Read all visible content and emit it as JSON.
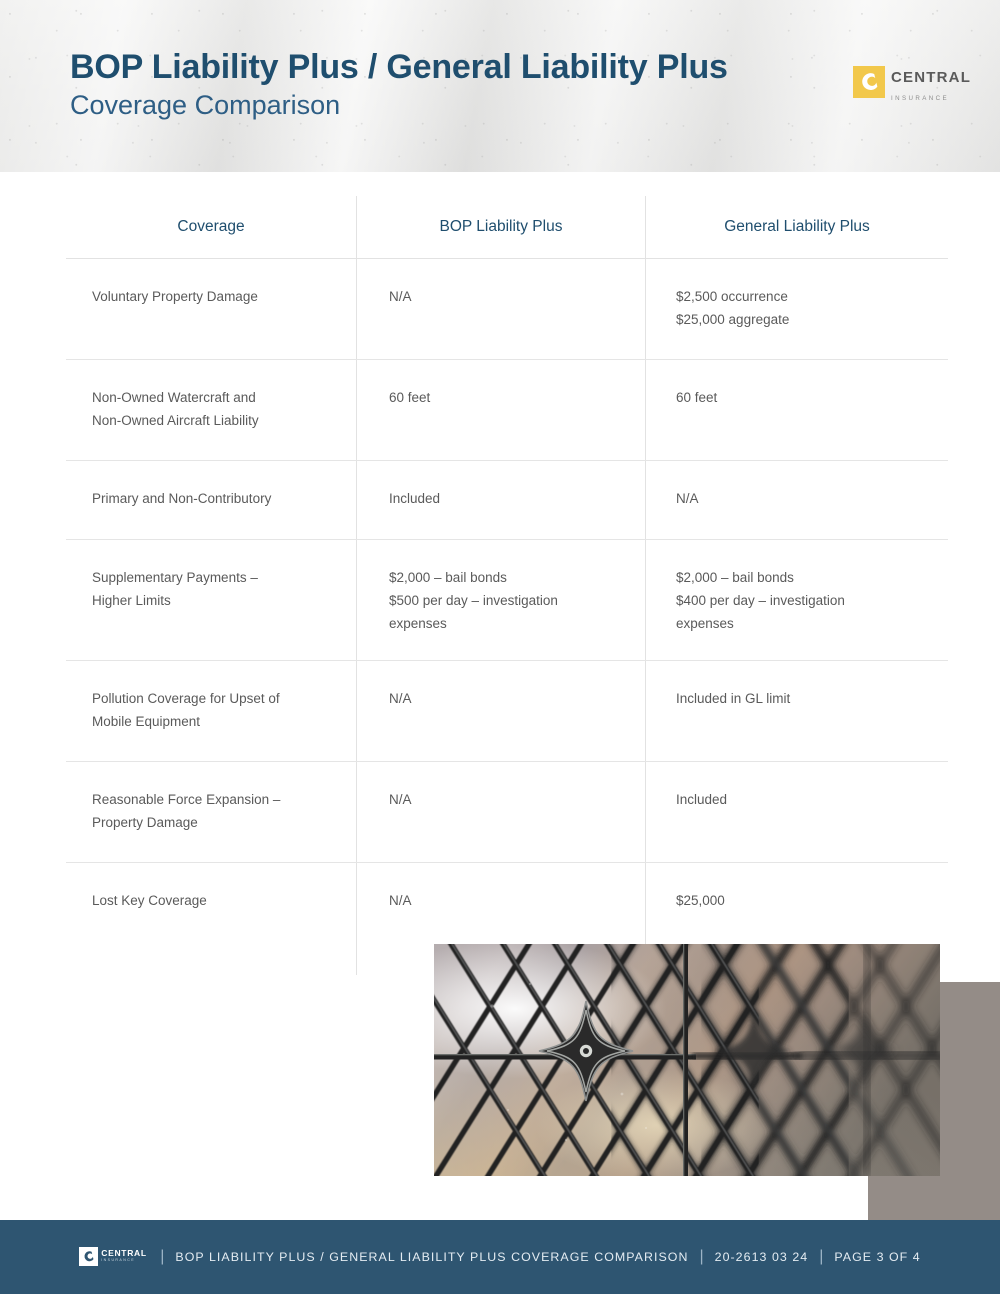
{
  "header": {
    "title": "BOP Liability Plus / General Liability Plus",
    "subtitle": "Coverage Comparison",
    "logo": {
      "name": "CENTRAL",
      "sub": "INSURANCE"
    },
    "colors": {
      "title": "#1F4E6E",
      "subtitle": "#2E5E85",
      "logo_gold": "#F2C84B"
    }
  },
  "table": {
    "columns": [
      "Coverage",
      "BOP Liability Plus",
      "General Liability Plus"
    ],
    "rows": [
      {
        "coverage": [
          "Voluntary Property Damage"
        ],
        "bop": [
          "N/A"
        ],
        "gl": [
          "$2,500 occurrence",
          "$25,000 aggregate"
        ]
      },
      {
        "coverage": [
          "Non-Owned Watercraft and",
          "Non-Owned Aircraft Liability"
        ],
        "bop": [
          "60 feet"
        ],
        "gl": [
          "60 feet"
        ]
      },
      {
        "coverage": [
          "Primary and Non-Contributory"
        ],
        "bop": [
          "Included"
        ],
        "gl": [
          "N/A"
        ]
      },
      {
        "coverage": [
          "Supplementary Payments –",
          "Higher Limits"
        ],
        "bop": [
          "$2,000 – bail bonds",
          "$500 per day – investigation",
          "expenses"
        ],
        "gl": [
          "$2,000 – bail bonds",
          "$400 per day – investigation",
          "expenses"
        ]
      },
      {
        "coverage": [
          "Pollution Coverage for Upset of",
          "Mobile Equipment"
        ],
        "bop": [
          "N/A"
        ],
        "gl": [
          "Included in GL limit"
        ]
      },
      {
        "coverage": [
          "Reasonable Force Expansion –",
          "Property Damage"
        ],
        "bop": [
          "N/A"
        ],
        "gl": [
          "Included"
        ]
      },
      {
        "coverage": [
          "Lost Key Coverage"
        ],
        "bop": [
          "N/A"
        ],
        "gl": [
          "$25,000"
        ]
      }
    ]
  },
  "photo": {
    "alt": "Leaded glass window with diamond lattice and four-point star rosette"
  },
  "accent": {
    "color": "#948C87"
  },
  "footer": {
    "logo": {
      "name": "CENTRAL",
      "sub": "INSURANCE"
    },
    "document_title": "BOP LIABILITY PLUS / GENERAL LIABILITY PLUS COVERAGE COMPARISON",
    "document_number": "20-2613 03 24",
    "page_label": "PAGE 3 OF 4",
    "separator": "|",
    "color": "#2E5571"
  }
}
